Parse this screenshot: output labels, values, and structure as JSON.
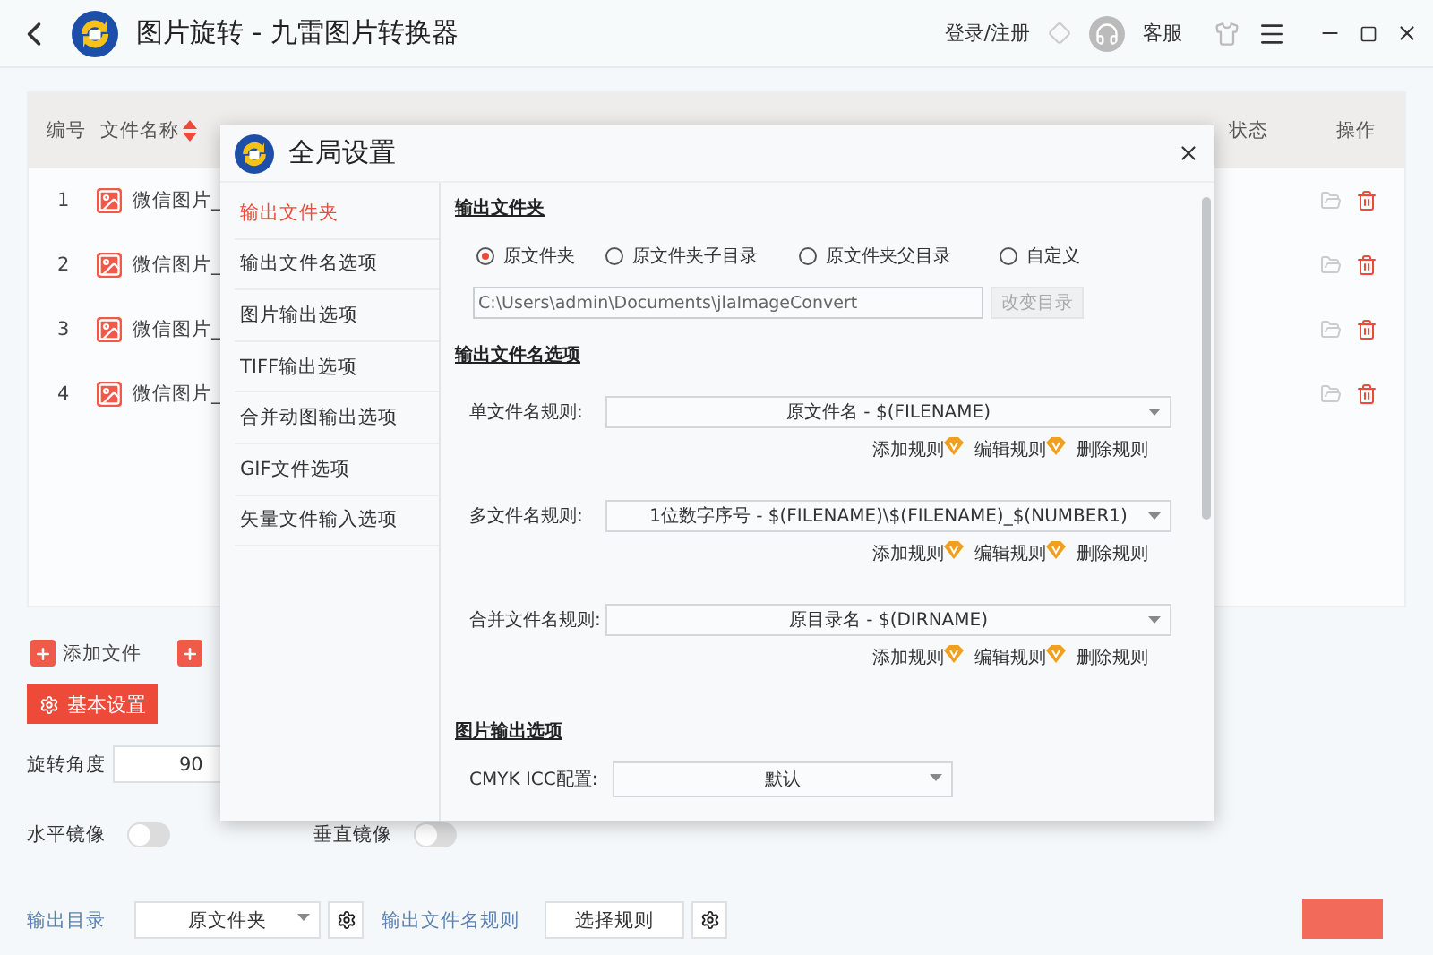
{
  "app": {
    "title": "图片旋转 - 九雷图片转换器",
    "login": "登录/注册",
    "service": "客服"
  },
  "table": {
    "columns": [
      {
        "label": "编号",
        "sortable": false
      },
      {
        "label": "文件名称",
        "sortable": true
      },
      {
        "label": "状态",
        "sortable": false
      },
      {
        "label": "操作",
        "sortable": false
      }
    ],
    "rows": [
      {
        "index": "1",
        "name": "微信图片_"
      },
      {
        "index": "2",
        "name": "微信图片_"
      },
      {
        "index": "3",
        "name": "微信图片_"
      },
      {
        "index": "4",
        "name": "微信图片_"
      }
    ]
  },
  "actions": [
    {
      "kind": "labeled",
      "label": "添加文件"
    },
    {
      "kind": "icon"
    }
  ],
  "basic_settings": "基本设置",
  "rotation": {
    "label": "旋转角度",
    "value": "90"
  },
  "mirrors": [
    {
      "label": "水平镜像",
      "on": false
    },
    {
      "label": "垂直镜像",
      "on": false
    }
  ],
  "output": {
    "dir_label": "输出目录",
    "dir_value": "原文件夹",
    "rule_label": "输出文件名规则",
    "rule_button": "选择规则"
  },
  "dialog": {
    "title": "全局设置",
    "nav": [
      {
        "label": "输出文件夹",
        "selected": true
      },
      {
        "label": "输出文件名选项",
        "selected": false
      },
      {
        "label": "图片输出选项",
        "selected": false
      },
      {
        "label": "TIFF输出选项",
        "selected": false
      },
      {
        "label": "合并动图输出选项",
        "selected": false
      },
      {
        "label": "GIF文件选项",
        "selected": false
      },
      {
        "label": "矢量文件输入选项",
        "selected": false
      }
    ],
    "folder": {
      "heading": "输出文件夹",
      "options": [
        {
          "label": "原文件夹",
          "selected": true
        },
        {
          "label": "原文件夹子目录",
          "selected": false
        },
        {
          "label": "原文件夹父目录",
          "selected": false
        },
        {
          "label": "自定义",
          "selected": false
        }
      ],
      "path": "C:\\Users\\admin\\Documents\\jlaImageConvert",
      "change_button": {
        "label": "改变目录",
        "disabled": true
      }
    },
    "naming": {
      "heading": "输出文件名选项",
      "rules": [
        {
          "label": "单文件名规则:",
          "value": "原文件名 - $(FILENAME)",
          "links": [
            {
              "label": "添加规则",
              "vip": true
            },
            {
              "label": "编辑规则",
              "vip": true
            },
            {
              "label": "删除规则",
              "vip": false
            }
          ]
        },
        {
          "label": "多文件名规则:",
          "value": "1位数字序号 - $(FILENAME)\\$(FILENAME)_$(NUMBER1)",
          "links": [
            {
              "label": "添加规则",
              "vip": true
            },
            {
              "label": "编辑规则",
              "vip": true
            },
            {
              "label": "删除规则",
              "vip": false
            }
          ]
        },
        {
          "label": "合并文件名规则:",
          "value": "原目录名 - $(DIRNAME)",
          "links": [
            {
              "label": "添加规则",
              "vip": true
            },
            {
              "label": "编辑规则",
              "vip": true
            },
            {
              "label": "删除规则",
              "vip": false
            }
          ]
        }
      ]
    },
    "image": {
      "heading": "图片输出选项",
      "label": "CMYK ICC配置:",
      "value": "默认"
    }
  }
}
